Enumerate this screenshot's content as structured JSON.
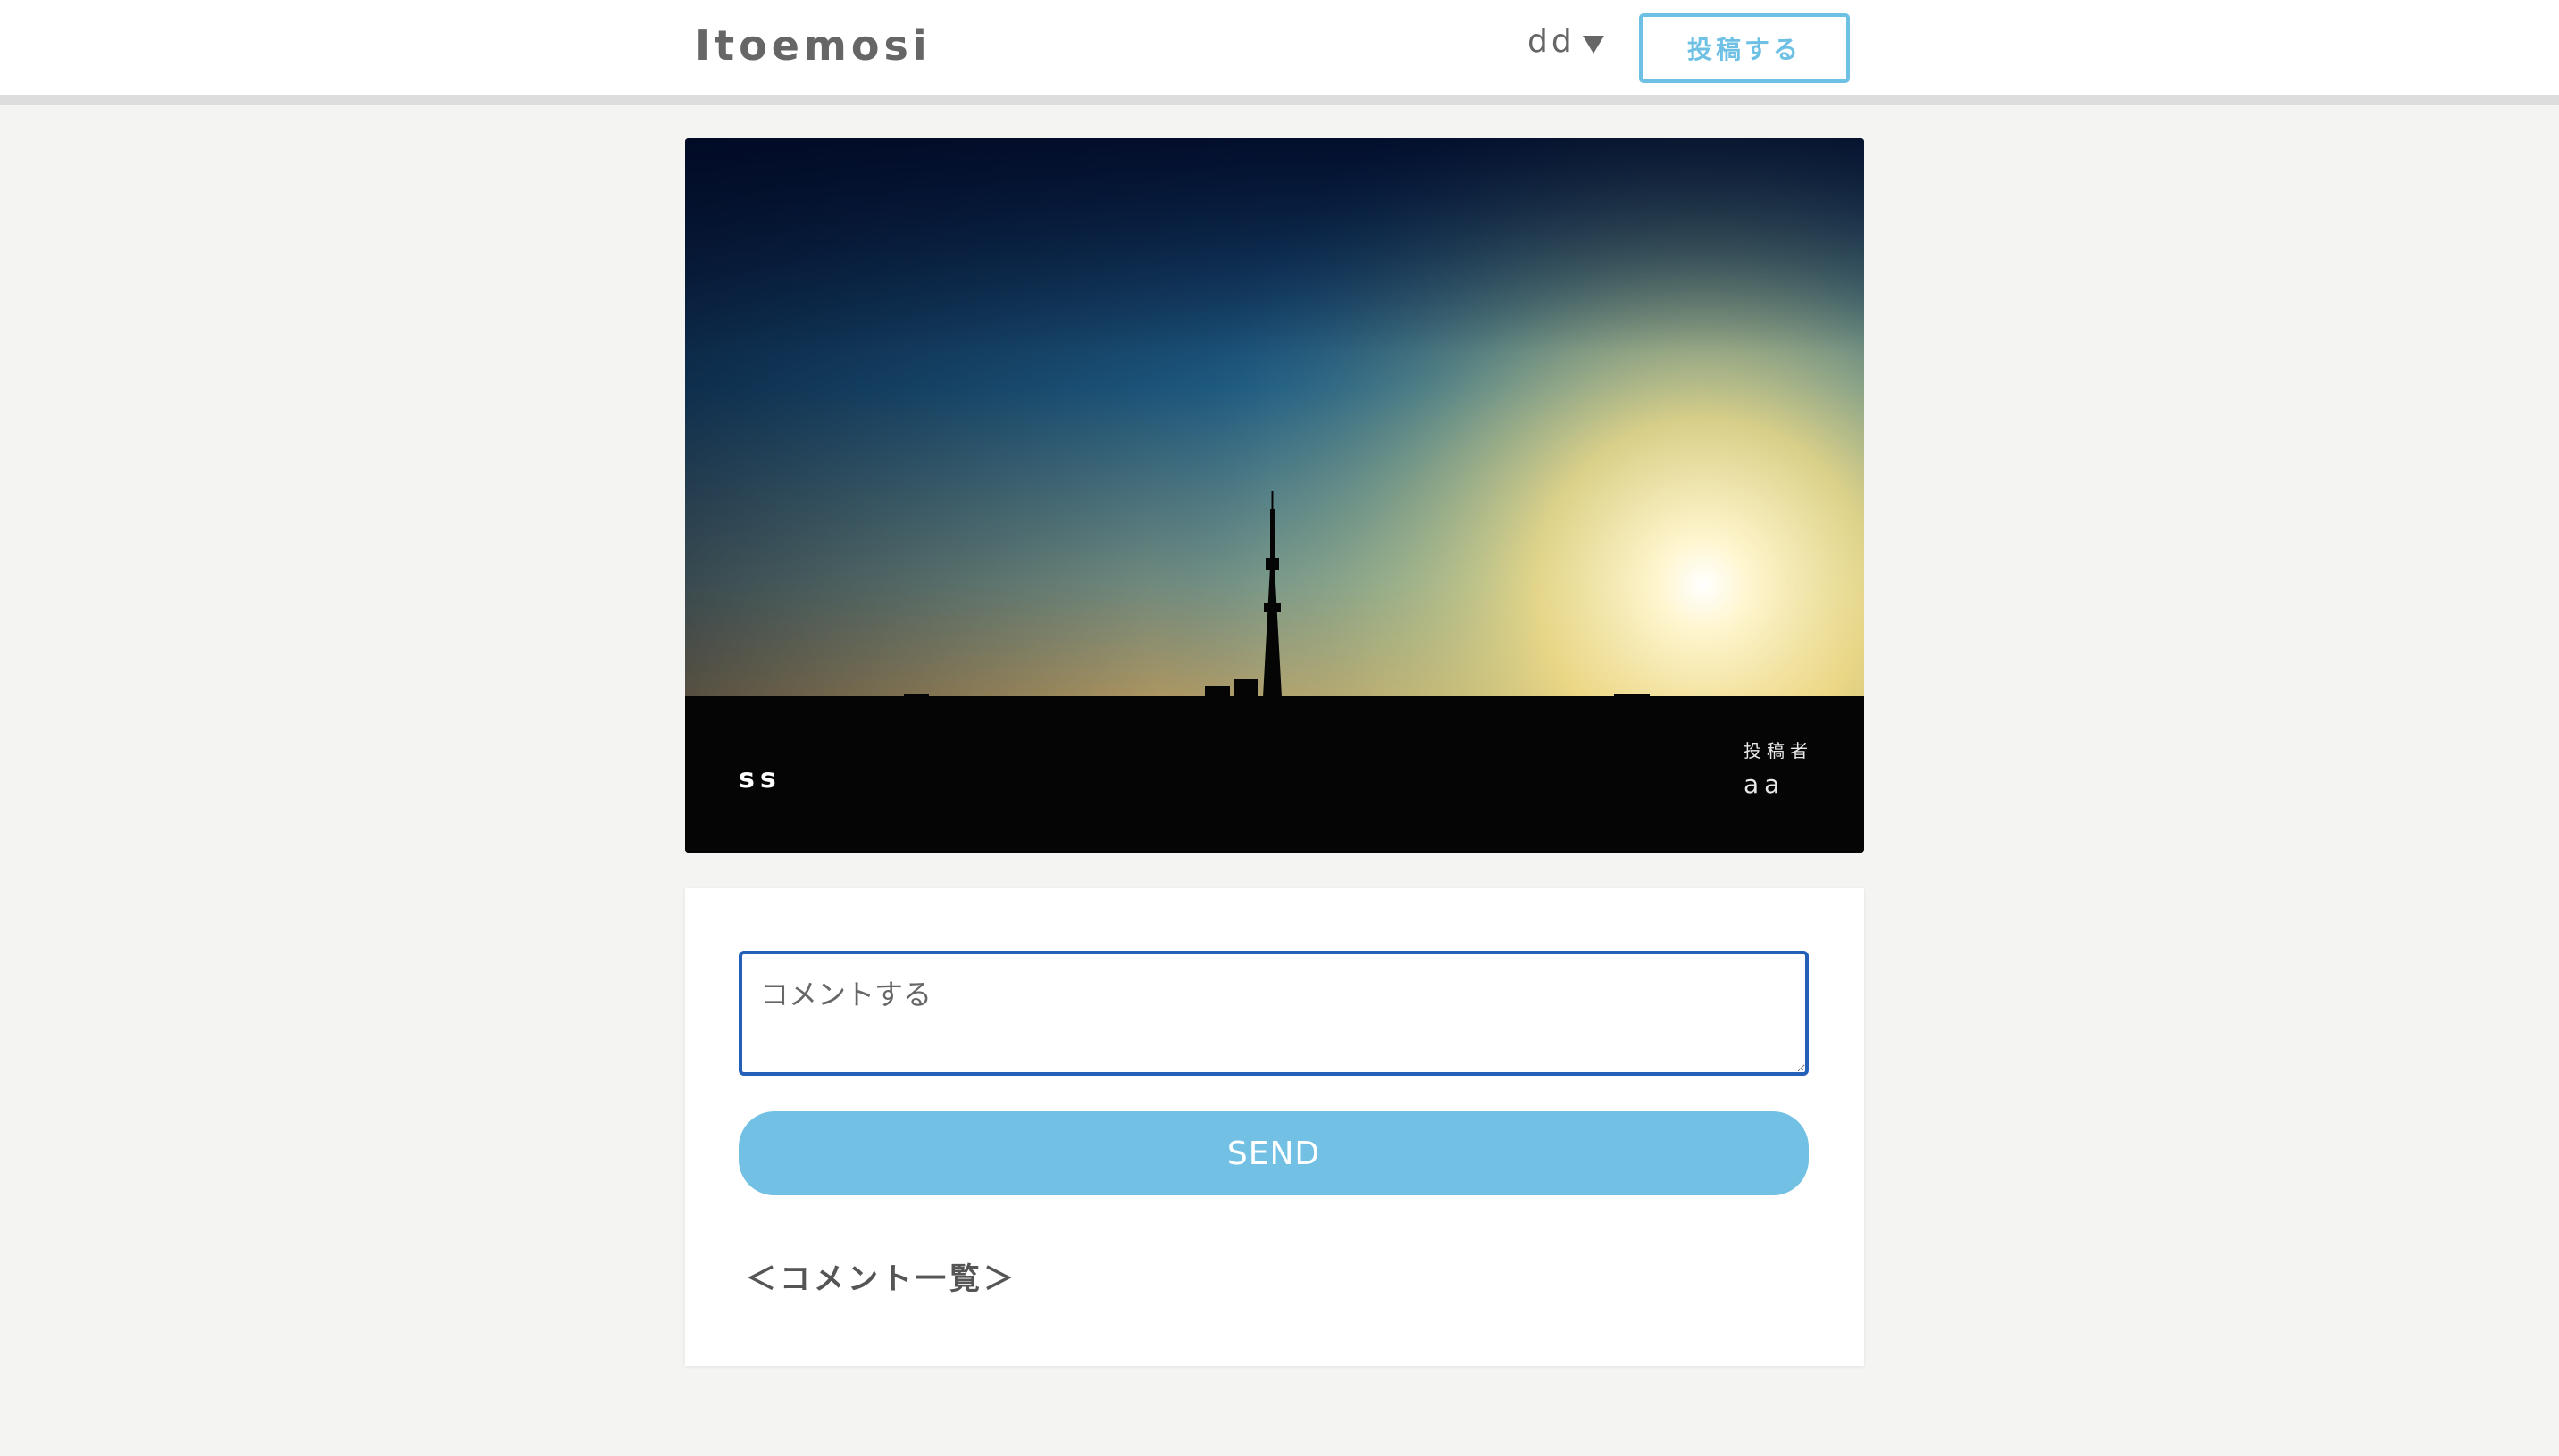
{
  "header": {
    "logo": "Itoemosi",
    "user_name": "dd",
    "post_button_label": "投稿する"
  },
  "photo": {
    "title": "ss",
    "poster_label": "投稿者",
    "poster_name": "aa",
    "scene": "skyline-sunset-photo"
  },
  "comment": {
    "placeholder": "コメントする",
    "value": "",
    "send_label": "SEND",
    "list_heading": "＜コメント一覧＞"
  },
  "colors": {
    "accent": "#6ec1e4",
    "send_button": "#72c1e4",
    "input_focus_border": "#2560b8",
    "page_background": "#f4f4f2"
  }
}
